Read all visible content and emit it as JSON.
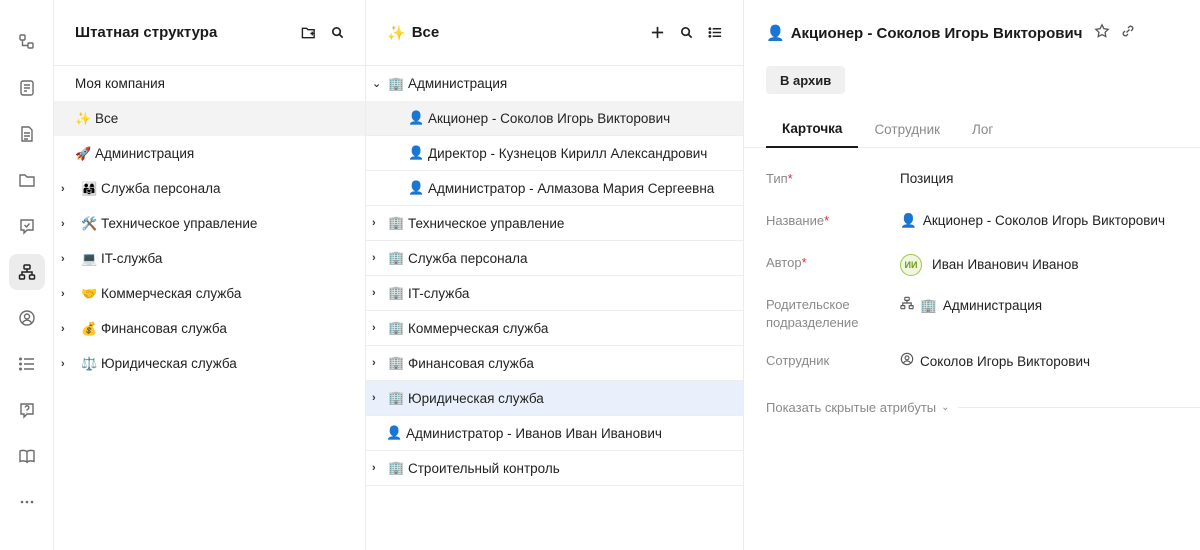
{
  "panel1": {
    "title": "Штатная структура",
    "items": [
      {
        "label": "Моя компания",
        "icon": "",
        "chevron": false
      },
      {
        "label": "Все",
        "icon": "✨",
        "chevron": false
      },
      {
        "label": "Администрация",
        "icon": "🚀",
        "chevron": false
      },
      {
        "label": "Служба персонала",
        "icon": "👨‍👩‍👧",
        "chevron": true
      },
      {
        "label": "Техническое управление",
        "icon": "🛠️",
        "chevron": true
      },
      {
        "label": "IT-служба",
        "icon": "💻",
        "chevron": true
      },
      {
        "label": "Коммерческая служба",
        "icon": "🤝",
        "chevron": true
      },
      {
        "label": "Финансовая служба",
        "icon": "💰",
        "chevron": true
      },
      {
        "label": "Юридическая служба",
        "icon": "⚖️",
        "chevron": true
      }
    ]
  },
  "panel2": {
    "title": "Все",
    "title_icon": "✨",
    "items": [
      {
        "label": "Администрация",
        "icon": "🏢",
        "chev": "⌄",
        "kind": "root"
      },
      {
        "label": "Акционер - Соколов Игорь Викторович",
        "icon": "👤",
        "chev": "",
        "kind": "child"
      },
      {
        "label": "Директор - Кузнецов Кирилл Александрович",
        "icon": "👤",
        "chev": "",
        "kind": "child"
      },
      {
        "label": "Администратор - Алмазова Мария Сергеевна",
        "icon": "👤",
        "chev": "",
        "kind": "child"
      },
      {
        "label": "Техническое управление",
        "icon": "🏢",
        "chev": "›",
        "kind": "root"
      },
      {
        "label": "Служба персонала",
        "icon": "🏢",
        "chev": "›",
        "kind": "root"
      },
      {
        "label": "IT-служба",
        "icon": "🏢",
        "chev": "›",
        "kind": "root"
      },
      {
        "label": "Коммерческая служба",
        "icon": "🏢",
        "chev": "›",
        "kind": "root"
      },
      {
        "label": "Финансовая служба",
        "icon": "🏢",
        "chev": "›",
        "kind": "root"
      },
      {
        "label": "Юридическая служба",
        "icon": "🏢",
        "chev": "›",
        "kind": "root"
      },
      {
        "label": "Администратор - Иванов Иван Иванович",
        "icon": "👤",
        "chev": "",
        "kind": "root"
      },
      {
        "label": "Строительный контроль",
        "icon": "🏢",
        "chev": "›",
        "kind": "root"
      }
    ]
  },
  "panel3": {
    "title": "Акционер - Соколов Игорь Викторович",
    "title_icon": "👤",
    "archive_label": "В архив",
    "tabs": [
      "Карточка",
      "Сотрудник",
      "Лог"
    ],
    "fields": {
      "type": {
        "label": "Тип",
        "value": "Позиция"
      },
      "name": {
        "label": "Название",
        "value": "Акционер - Соколов Игорь Викторович",
        "icon": "👤"
      },
      "author": {
        "label": "Автор",
        "value": "Иван Иванович Иванов",
        "avatar": "ИИ"
      },
      "parent": {
        "label": "Родительское подразделение",
        "value": "Администрация",
        "icon": "🏢"
      },
      "employee": {
        "label": "Сотрудник",
        "value": "Соколов Игорь Викторович"
      }
    },
    "show_hidden": "Показать скрытые атрибуты",
    "required_mark": "*"
  },
  "colors": {
    "accent_red": "#e03131",
    "highlight": "#eaf0fb",
    "avatar_green": "#9dc64b"
  }
}
